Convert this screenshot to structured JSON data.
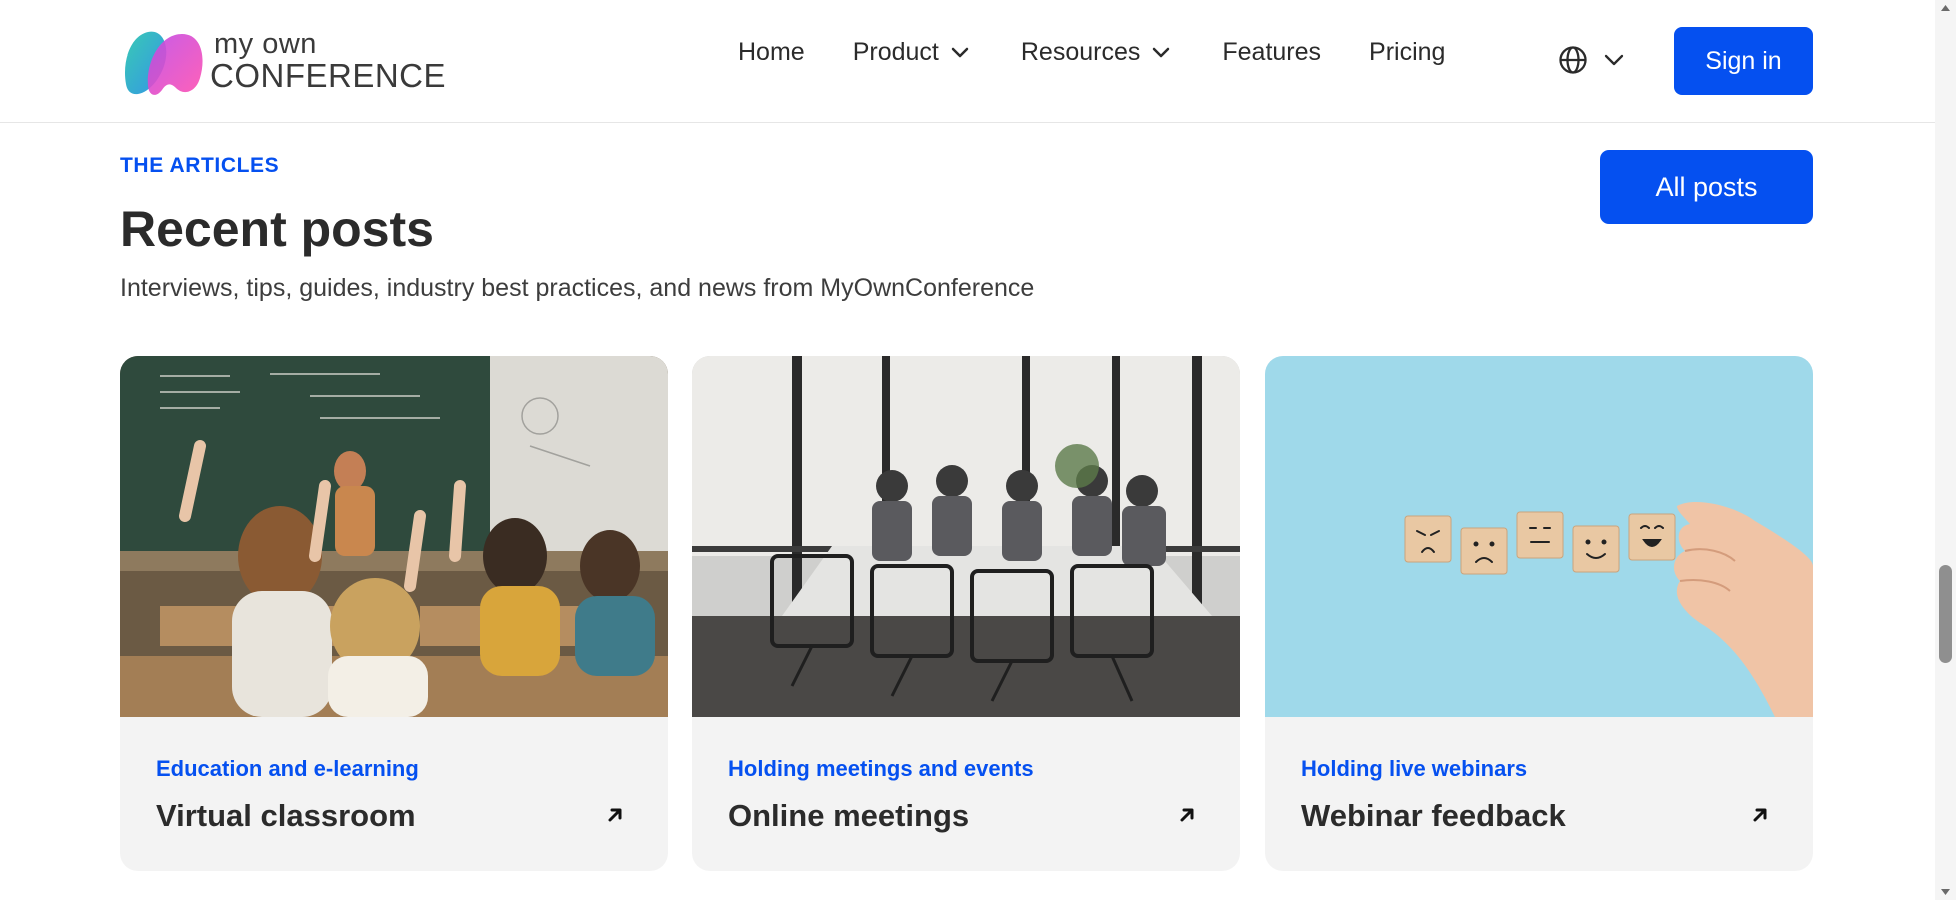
{
  "header": {
    "logo": {
      "line1": "my own",
      "line2": "CONFERENCE"
    },
    "nav": [
      {
        "label": "Home",
        "has_dropdown": false
      },
      {
        "label": "Product",
        "has_dropdown": true
      },
      {
        "label": "Resources",
        "has_dropdown": true
      },
      {
        "label": "Features",
        "has_dropdown": false
      },
      {
        "label": "Pricing",
        "has_dropdown": false
      }
    ],
    "language_icon": "globe-icon",
    "sign_in_label": "Sign in"
  },
  "section": {
    "eyebrow": "THE ARTICLES",
    "title": "Recent posts",
    "subtitle": "Interviews, tips, guides, industry best practices, and news from MyOwnConference",
    "all_posts_label": "All posts"
  },
  "cards": [
    {
      "category": "Education and e-learning",
      "title": "Virtual classroom",
      "image": "classroom-photo"
    },
    {
      "category": "Holding meetings and events",
      "title": "Online meetings",
      "image": "meeting-room-photo"
    },
    {
      "category": "Holding live webinars",
      "title": "Webinar feedback",
      "image": "feedback-cubes-photo"
    }
  ],
  "colors": {
    "accent": "#0550f0",
    "card_bg": "#f3f3f3",
    "text": "#2b2b2b"
  }
}
